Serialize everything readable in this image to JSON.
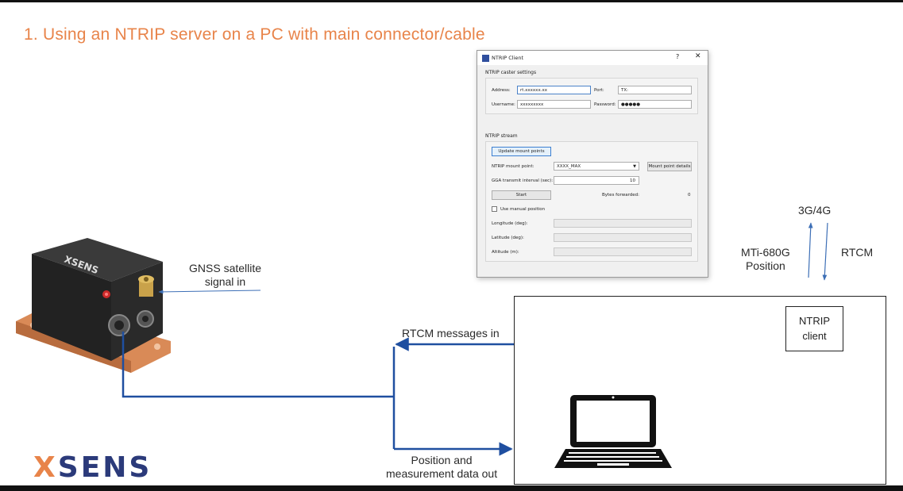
{
  "slide": {
    "title": "1.  Using an NTRIP server on a PC with main connector/cable"
  },
  "dialog": {
    "title": "NTRIP Client",
    "help_label": "?",
    "close_label": "✕",
    "caster_group_label": "NTRIP caster settings",
    "address_label": "Address:",
    "address_value": "rt.xxxxxx.xx",
    "port_label": "Port:",
    "port_value": "TX:",
    "username_label": "Username:",
    "username_value": "xxxxxxxxx",
    "password_label": "Password:",
    "password_value": "●●●●●",
    "stream_group_label": "NTRIP stream",
    "update_button": "Update mount points",
    "mountpoint_label": "NTRIP mount point:",
    "mountpoint_value": "XXXX_MAX",
    "mountpoint_details_button": "Mount point details",
    "gga_label": "GGA transmit interval (sec):",
    "gga_value": "10",
    "start_button": "Start",
    "bytes_label": "Bytes forwarded:",
    "bytes_value": "0",
    "manual_position_label": "Use manual position",
    "longitude_label": "Longitude (deg):",
    "latitude_label": "Latitude (deg):",
    "altitude_label": "Altitude (m):"
  },
  "diagram": {
    "gnss_line1": "GNSS satellite",
    "gnss_line2": "signal in",
    "rtcm_in": "RTCM messages in",
    "position_line1": "Position and",
    "position_line2": "measurement data out",
    "network": "3G/4G",
    "mti_line1": "MTi-680G",
    "mti_line2": "Position",
    "rtcm": "RTCM",
    "ntrip_line1": "NTRIP",
    "ntrip_line2": "client",
    "device_brand": "XSENS"
  },
  "logo": {
    "x": "X",
    "rest": "SENS"
  },
  "colors": {
    "title": "#e8844a",
    "cable": "#1f4fa0",
    "logo_blue": "#2b3a7a",
    "logo_orange": "#e8844a",
    "device_base": "#d98a57"
  }
}
